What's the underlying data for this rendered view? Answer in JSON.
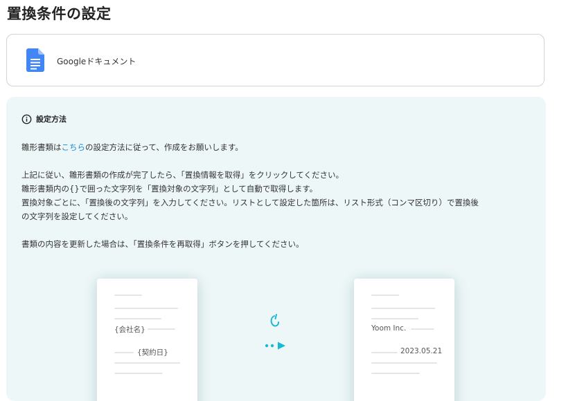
{
  "header": {
    "title": "置換条件の設定"
  },
  "app": {
    "name": "Googleドキュメント",
    "icon": "google-docs-icon",
    "accent": "#4285f4"
  },
  "info": {
    "title": "設定方法",
    "line1_prefix": "雛形書類は",
    "line1_link": "こちら",
    "line1_suffix": "の設定方法に従って、作成をお願いします。",
    "line2": "上記に従い、雛形書類の作成が完了したら、「置換情報を取得」をクリックしてください。",
    "line3": "雛形書類内の{}で囲った文字列を「置換対象の文字列」として自動で取得します。",
    "line4": "置換対象ごとに、「置換後の文字列」を入力してください。リストとして設定した箇所は、リスト形式（コンマ区切り）で置換後",
    "line5": "の文字列を設定してください。",
    "line6": "書類の内容を更新した場合は、「置換条件を再取得」ボタンを押してください。"
  },
  "illustration": {
    "template_card": {
      "company_placeholder": "{会社名}",
      "date_placeholder": "{契約日}"
    },
    "result_card": {
      "company": "Yoom Inc.",
      "date": "2023.05.21"
    },
    "accent_color": "#19b8d6"
  }
}
